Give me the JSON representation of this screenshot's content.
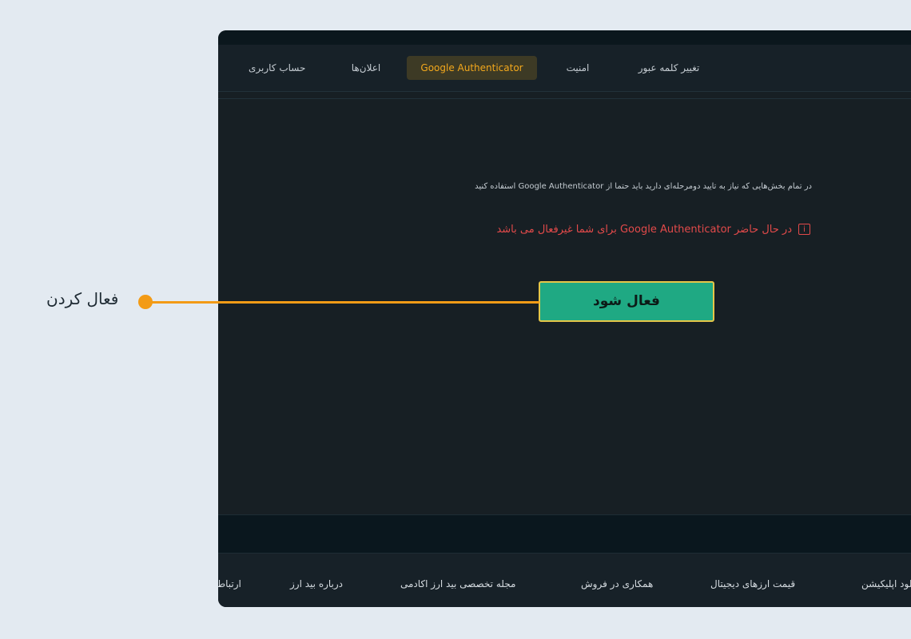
{
  "tabs": {
    "account": "حساب کاربری",
    "notifications": "اعلان‌ها",
    "google_auth": "Google Authenticator",
    "security": "امنیت",
    "change_password": "تغییر کلمه عبور"
  },
  "main": {
    "description": "در تمام بخش‌هایی که نیاز به تایید دومرحله‌ای دارید باید حتما از Google Authenticator استفاده کنید",
    "warning": "در حال حاضر Google Authenticator برای شما غیرفعال می باشد",
    "warning_icon": "i",
    "activate_label": "فعال شود"
  },
  "footer": {
    "contact": "ارتباط",
    "about": "درباره بید ارز",
    "magazine": "مجله تخصصی بید ارز اکادمی",
    "affiliate": "همکاری در فروش",
    "prices": "قیمت ارزهای دیجیتال",
    "app": "دانلود اپلیکیشن"
  },
  "callout": {
    "label": "فعال کردن"
  },
  "colors": {
    "accent": "#f3a81c",
    "active_button": "#1fa983",
    "warning": "#e34a4a",
    "callout": "#f39b16"
  }
}
